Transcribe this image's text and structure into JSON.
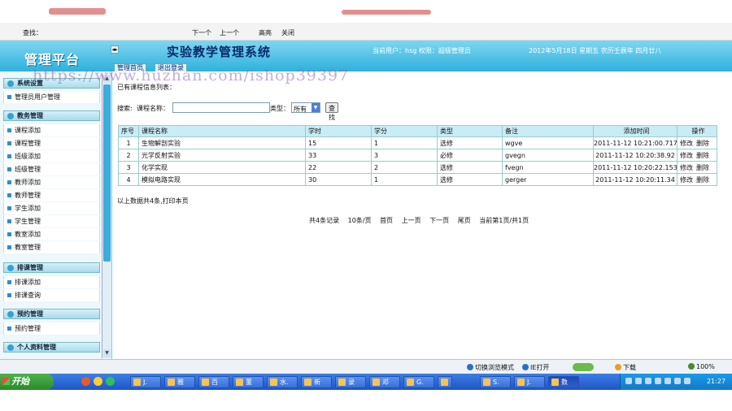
{
  "findbar": {
    "label": "查找：",
    "next": "下一个",
    "prev": "上一个",
    "highlight": "高亮",
    "close": "关闭"
  },
  "header": {
    "logo": "管理平台",
    "system_title": "实验教学管理系统",
    "current_user": "当前用户：hsg 权限：超级管理员",
    "date": "2012年5月18日 星期五 农历壬辰年 四月廿八",
    "tabs": [
      "管理首页",
      "退出登录"
    ]
  },
  "watermark": "https://www.huzhan.com/ishop39397",
  "sidebar": {
    "sections": [
      {
        "title": "系统设置",
        "items": [
          "管理员用户管理"
        ]
      },
      {
        "title": "教务管理",
        "items": [
          "课程添加",
          "课程管理",
          "班级添加",
          "班级管理",
          "教师添加",
          "教师管理",
          "学生添加",
          "学生管理",
          "教室添加",
          "教室管理"
        ]
      },
      {
        "title": "排课管理",
        "items": [
          "排课添加",
          "排课查询"
        ]
      },
      {
        "title": "预约管理",
        "items": [
          "预约管理"
        ]
      },
      {
        "title": "个人资料管理",
        "items": []
      }
    ]
  },
  "main": {
    "caption": "已有课程信息列表：",
    "search": {
      "label": "搜索:",
      "name_label": "课程名称：",
      "name_value": "",
      "type_label": "类型：",
      "type_selected": "所有",
      "button": "查找"
    },
    "table": {
      "columns": [
        "序号",
        "课程名称",
        "学时",
        "学分",
        "类型",
        "备注",
        "添加时间",
        "操作"
      ],
      "rows": [
        [
          "1",
          "生物解剖实验",
          "15",
          "1",
          "选修",
          "wgve",
          "2011-11-12 10:21:00.717"
        ],
        [
          "2",
          "光学反射实验",
          "33",
          "3",
          "必修",
          "gvegn",
          "2011-11-12 10:20:38.92"
        ],
        [
          "3",
          "化学实现",
          "22",
          "2",
          "选修",
          "fvegn",
          "2011-11-12 10:20:22.153"
        ],
        [
          "4",
          "模拟电路实现",
          "30",
          "1",
          "选修",
          "gerger",
          "2011-11-12 10:20:11.34"
        ]
      ],
      "actions": [
        "修改",
        "删除"
      ]
    },
    "summary": "以上数据共4条,打印本页",
    "pager": [
      "共4条记录",
      "10条/页",
      "首页",
      "上一页",
      "下一页",
      "尾页",
      "当前第1页/共1页"
    ]
  },
  "statusbar": {
    "compat": "切换浏览模式",
    "open": "IE打开",
    "download": "下载",
    "zoom": "100%"
  },
  "taskbar": {
    "start": "开始",
    "tasks": [
      "J.",
      "雅",
      "百",
      "董",
      "水.",
      "新",
      "录",
      "邓",
      "G.",
      "",
      "S.",
      "J.",
      "数"
    ],
    "clock": "21:27"
  }
}
